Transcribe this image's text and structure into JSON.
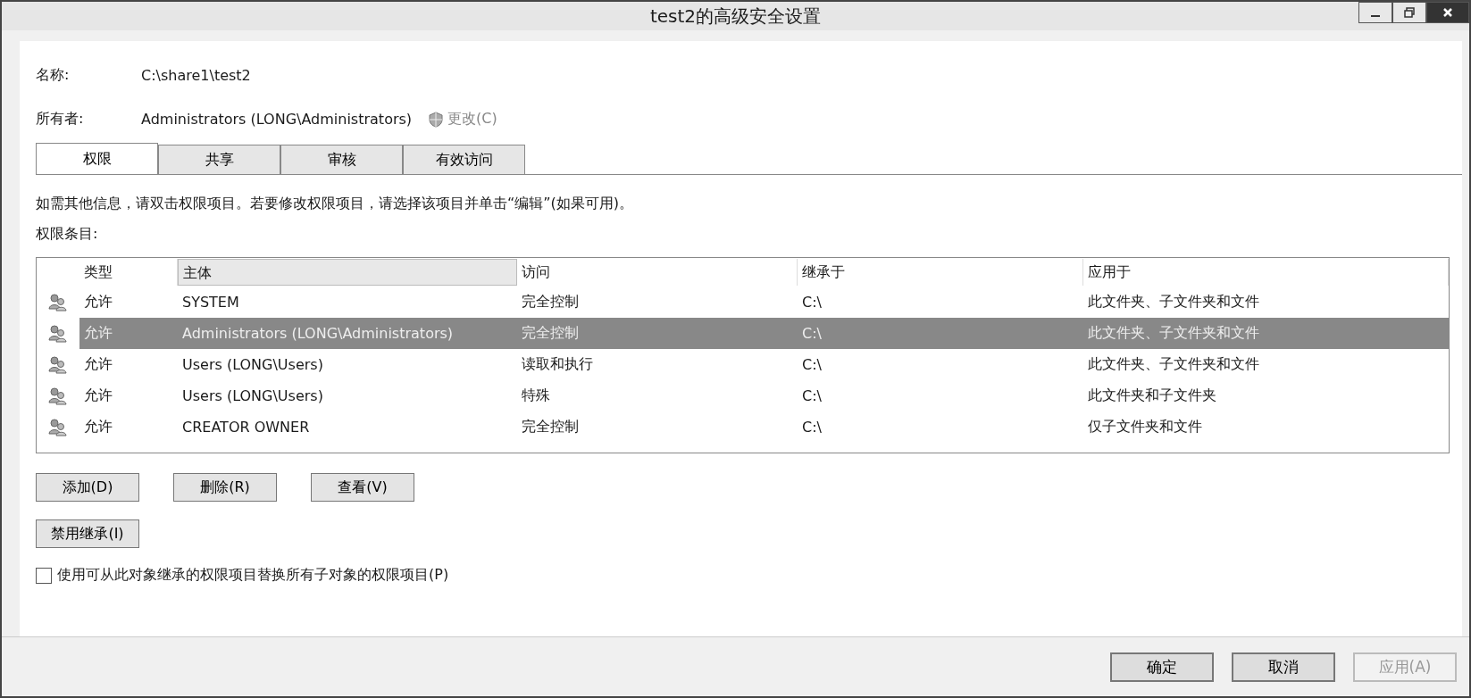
{
  "window": {
    "title": "test2的高级安全设置"
  },
  "name": {
    "label": "名称:",
    "value": "C:\\share1\\test2"
  },
  "owner": {
    "label": "所有者:",
    "value": "Administrators (LONG\\Administrators)",
    "change": "更改(C)"
  },
  "tabs": [
    {
      "label": "权限",
      "selected": true
    },
    {
      "label": "共享",
      "selected": false
    },
    {
      "label": "审核",
      "selected": false
    },
    {
      "label": "有效访问",
      "selected": false
    }
  ],
  "info": "如需其他信息，请双击权限项目。若要修改权限项目，请选择该项目并单击“编辑”(如果可用)。",
  "entries_label": "权限条目:",
  "table": {
    "columns": [
      "类型",
      "主体",
      "访问",
      "继承于",
      "应用于"
    ],
    "rows": [
      {
        "cells": [
          "允许",
          "SYSTEM",
          "完全控制",
          "C:\\",
          "此文件夹、子文件夹和文件"
        ],
        "selected": false
      },
      {
        "cells": [
          "允许",
          "Administrators (LONG\\Administrators)",
          "完全控制",
          "C:\\",
          "此文件夹、子文件夹和文件"
        ],
        "selected": true
      },
      {
        "cells": [
          "允许",
          "Users (LONG\\Users)",
          "读取和执行",
          "C:\\",
          "此文件夹、子文件夹和文件"
        ],
        "selected": false
      },
      {
        "cells": [
          "允许",
          "Users (LONG\\Users)",
          "特殊",
          "C:\\",
          "此文件夹和子文件夹"
        ],
        "selected": false
      },
      {
        "cells": [
          "允许",
          "CREATOR OWNER",
          "完全控制",
          "C:\\",
          "仅子文件夹和文件"
        ],
        "selected": false
      }
    ]
  },
  "entry_buttons": [
    "添加(D)",
    "删除(R)",
    "查看(V)"
  ],
  "disable_inheritance": "禁用继承(I)",
  "replace_checkbox": {
    "label": "使用可从此对象继承的权限项目替换所有子对象的权限项目(P)",
    "checked": false
  },
  "footer_buttons": [
    {
      "label": "确定",
      "disabled": false
    },
    {
      "label": "取消",
      "disabled": false
    },
    {
      "label": "应用(A)",
      "disabled": true
    }
  ]
}
